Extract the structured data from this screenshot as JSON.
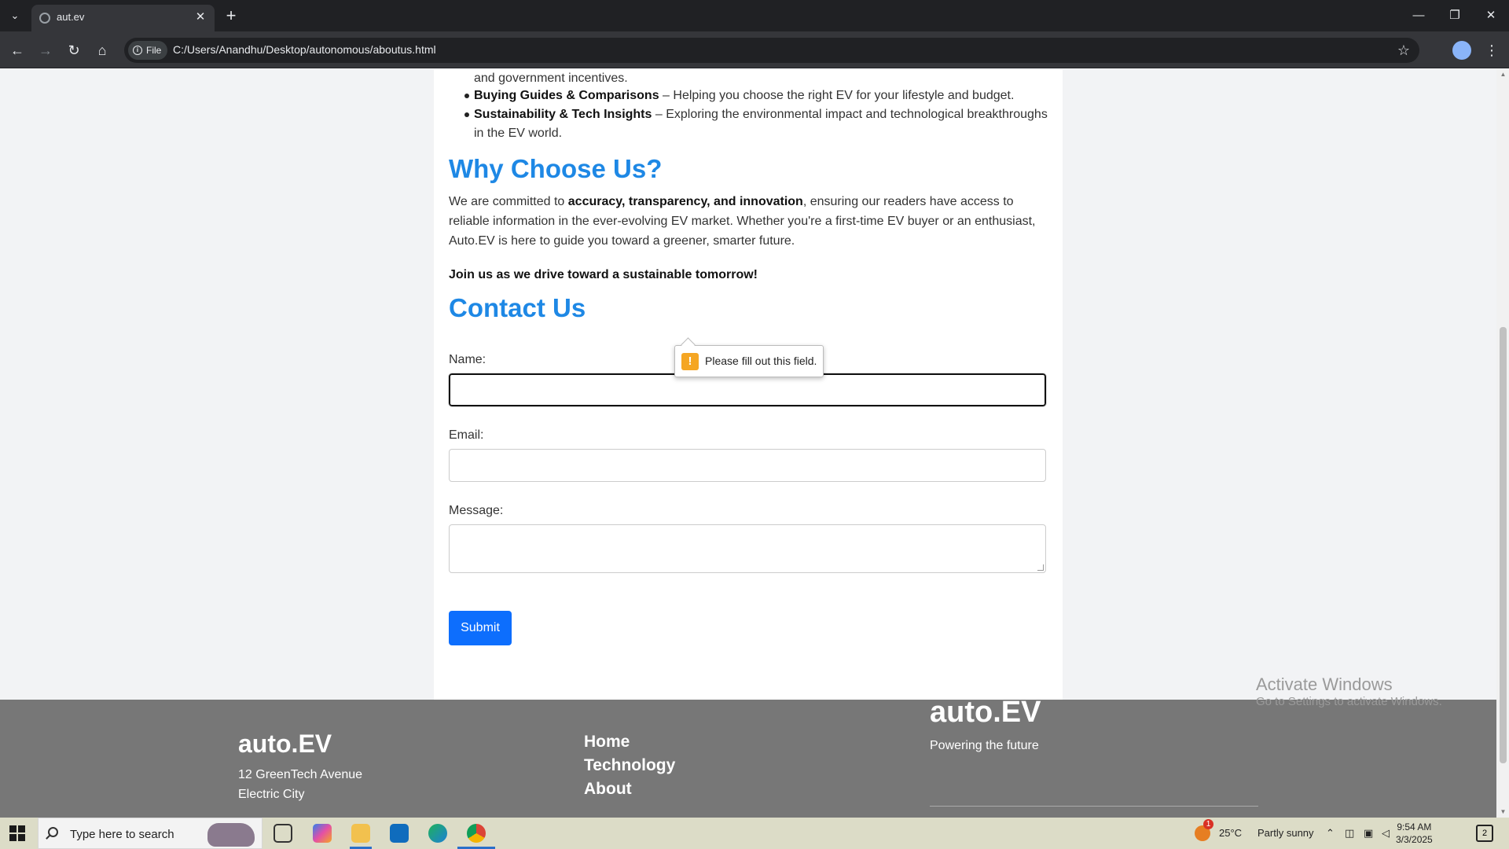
{
  "browser": {
    "tab_title": "aut.ev",
    "file_chip": "File",
    "url": "C:/Users/Anandhu/Desktop/autonomous/aboutus.html",
    "win_minimize": "—",
    "win_restore": "❐",
    "win_close": "✕",
    "tab_close": "✕",
    "new_tab": "+",
    "tab_list": "⌄",
    "back": "←",
    "forward": "→",
    "reload": "↻",
    "home": "⌂",
    "star": "☆",
    "menu": "⋮"
  },
  "page": {
    "list_items": [
      {
        "cont": "and government incentives."
      },
      {
        "title": "Buying Guides & Comparisons",
        "text": " – Helping you choose the right EV for your lifestyle and budget."
      },
      {
        "title": "Sustainability & Tech Insights",
        "text": " – Exploring the environmental impact and technological breakthroughs",
        "cont": "in the EV world."
      }
    ],
    "why_heading": "Why Choose Us?",
    "why_para_pre": "We are committed to ",
    "why_para_bold": "accuracy, transparency, and innovation",
    "why_para_post": ", ensuring our readers have access to",
    "why_para_line2": "reliable information in the ever-evolving EV market. Whether you're a first-time EV buyer or an enthusiast,",
    "why_para_line3": "Auto.EV is here to guide you toward a greener, smarter future.",
    "join_text": "Join us as we drive toward a sustainable tomorrow!",
    "contact_heading": "Contact Us",
    "form": {
      "name_label": "Name:",
      "email_label": "Email:",
      "message_label": "Message:",
      "submit_label": "Submit",
      "name_value": "",
      "email_value": "",
      "message_value": ""
    },
    "validation_tooltip": "Please fill out this field.",
    "validation_icon": "!"
  },
  "footer": {
    "brand": "auto.EV",
    "address_line1": "12 GreenTech Avenue",
    "address_line2": "Electric City",
    "links": [
      "Home",
      "Technology",
      "About"
    ],
    "brand2": "auto.EV",
    "tagline": "Powering the future"
  },
  "watermark": {
    "line1": "Activate Windows",
    "line2": "Go to Settings to activate Windows."
  },
  "taskbar": {
    "search_placeholder": "Type here to search",
    "weather_temp": "25°C",
    "weather_text": "Partly sunny",
    "weather_badge": "1",
    "time": "9:54 AM",
    "date": "3/3/2025",
    "notification_count": "2"
  },
  "colors": {
    "heading_blue": "#1e88e5",
    "submit_blue": "#0d6efd",
    "footer_gray": "#777777",
    "warn_orange": "#f5a623"
  }
}
